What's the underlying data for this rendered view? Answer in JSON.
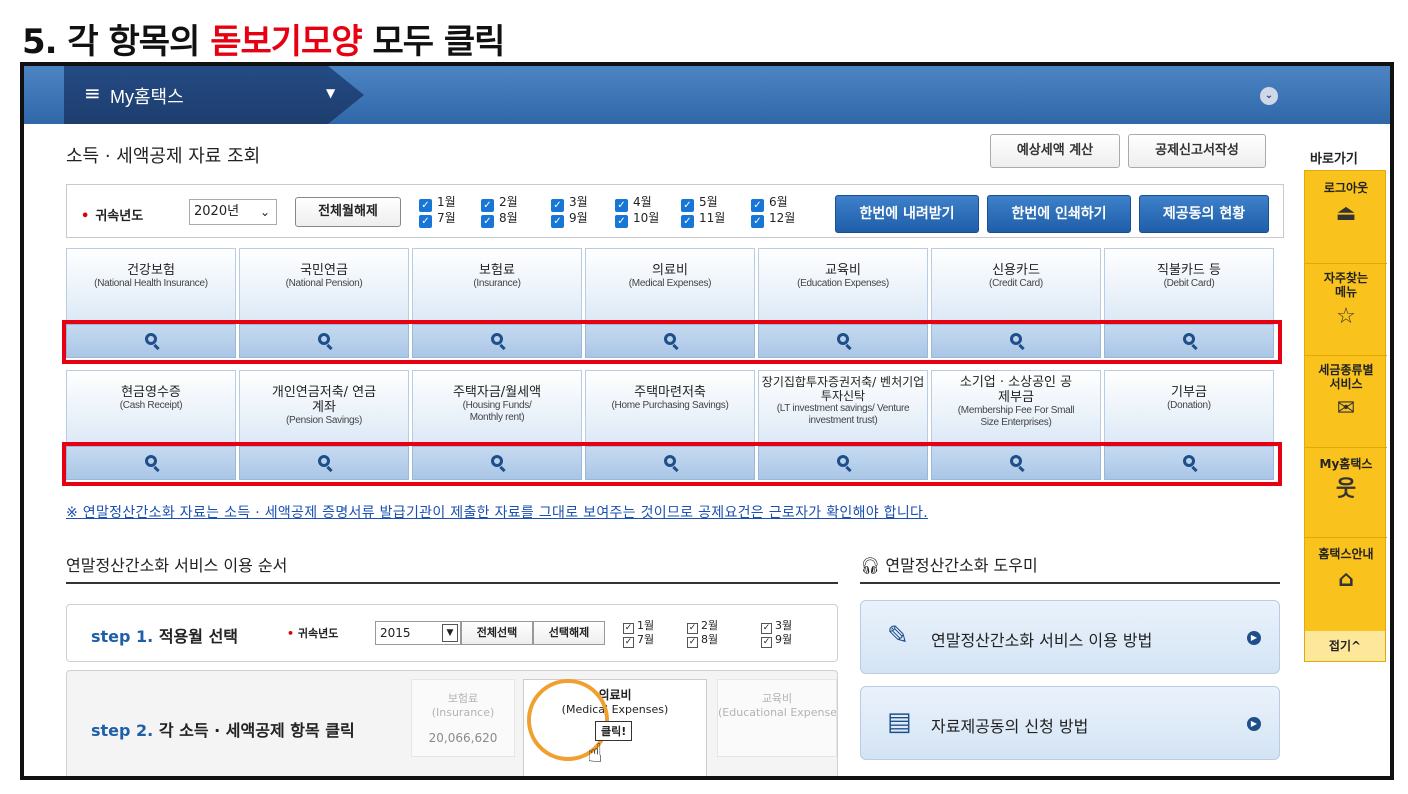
{
  "caption": {
    "prefix": "5. 각 항목의 ",
    "highlight": "돋보기모양",
    "suffix": " 모두 클릭"
  },
  "topbar": {
    "menu_icon": "≡",
    "title": "My홈택스",
    "caret": "▼",
    "right_icon": "⌄"
  },
  "quick": {
    "label": "바로가기",
    "items": [
      {
        "label": "로그아웃",
        "icon": "⏏"
      },
      {
        "label": "자주찾는 메뉴",
        "icon": "☆"
      },
      {
        "label": "세금종류별 서비스",
        "icon": "✉"
      },
      {
        "label": "My홈택스",
        "icon": "웃"
      },
      {
        "label": "홈택스안내",
        "icon": "⌂"
      }
    ],
    "collapse": "접기^"
  },
  "page": {
    "title": "소득 · 세액공제 자료 조회",
    "btn_estimate": "예상세액 계산",
    "btn_report": "공제신고서작성"
  },
  "filter": {
    "year_label": "귀속년도",
    "year_value": "2020년",
    "unselect_all": "전체월해제",
    "months": [
      "1월",
      "2월",
      "3월",
      "4월",
      "5월",
      "6월",
      "7월",
      "8월",
      "9월",
      "10월",
      "11월",
      "12월"
    ],
    "btn_download": "한번에 내려받기",
    "btn_print": "한번에 인쇄하기",
    "btn_status": "제공동의 현황"
  },
  "categories_row1": [
    {
      "ko": "건강보험",
      "en": "(National Health Insurance)"
    },
    {
      "ko": "국민연금",
      "en": "(National Pension)"
    },
    {
      "ko": "보험료",
      "en": "(Insurance)"
    },
    {
      "ko": "의료비",
      "en": "(Medical Expenses)"
    },
    {
      "ko": "교육비",
      "en": "(Education Expenses)"
    },
    {
      "ko": "신용카드",
      "en": "(Credit Card)"
    },
    {
      "ko": "직불카드 등",
      "en": "(Debit Card)"
    }
  ],
  "categories_row2": [
    {
      "ko": "현금영수증",
      "en": "(Cash Receipt)"
    },
    {
      "ko": "개인연금저축/ 연금계좌",
      "en": "(Pension Savings)"
    },
    {
      "ko": "주택자금/월세액",
      "en": "(Housing Funds/ Monthly rent)"
    },
    {
      "ko": "주택마련저축",
      "en": "(Home Purchasing Savings)"
    },
    {
      "ko": "장기집합투자증권저축/ 벤처기업투자신탁",
      "en": "(LT investment savings/ Venture investment trust)"
    },
    {
      "ko": "소기업 · 소상공인 공제부금",
      "en": "(Membership Fee For Small Size Enterprises)"
    },
    {
      "ko": "기부금",
      "en": "(Donation)"
    }
  ],
  "notice": "※ 연말정산간소화 자료는 소득 · 세액공제 증명서류 발급기관이 제출한 자료를 그대로 보여주는 것이므로 공제요건은 근로자가 확인해야 합니다.",
  "order": {
    "title": "연말정산간소화 서비스 이용 순서",
    "step1": {
      "num": "step 1.",
      "text": " 적용월 선택",
      "year_label": "귀속년도",
      "year": "2015",
      "btn_all": "전체선택",
      "btn_clear": "선택해제",
      "months": [
        "1월",
        "7월",
        "2월",
        "8월",
        "3월",
        "9월"
      ]
    },
    "step2": {
      "num": "step 2.",
      "text": " 각 소득 · 세액공제 항목 클릭",
      "ins_ko": "보험료",
      "ins_en": "(Insurance)",
      "ins_amount": "20,066,620",
      "med_ko": "의료비",
      "med_en": "(Medical Expenses)",
      "edu_ko": "교육비",
      "edu_en": "(Educational Expenses)",
      "tooltip": "클릭!"
    }
  },
  "helper": {
    "title": "연말정산간소화 도우미",
    "items": [
      "연말정산간소화 서비스 이용 방법",
      "자료제공동의 신청 방법"
    ]
  }
}
